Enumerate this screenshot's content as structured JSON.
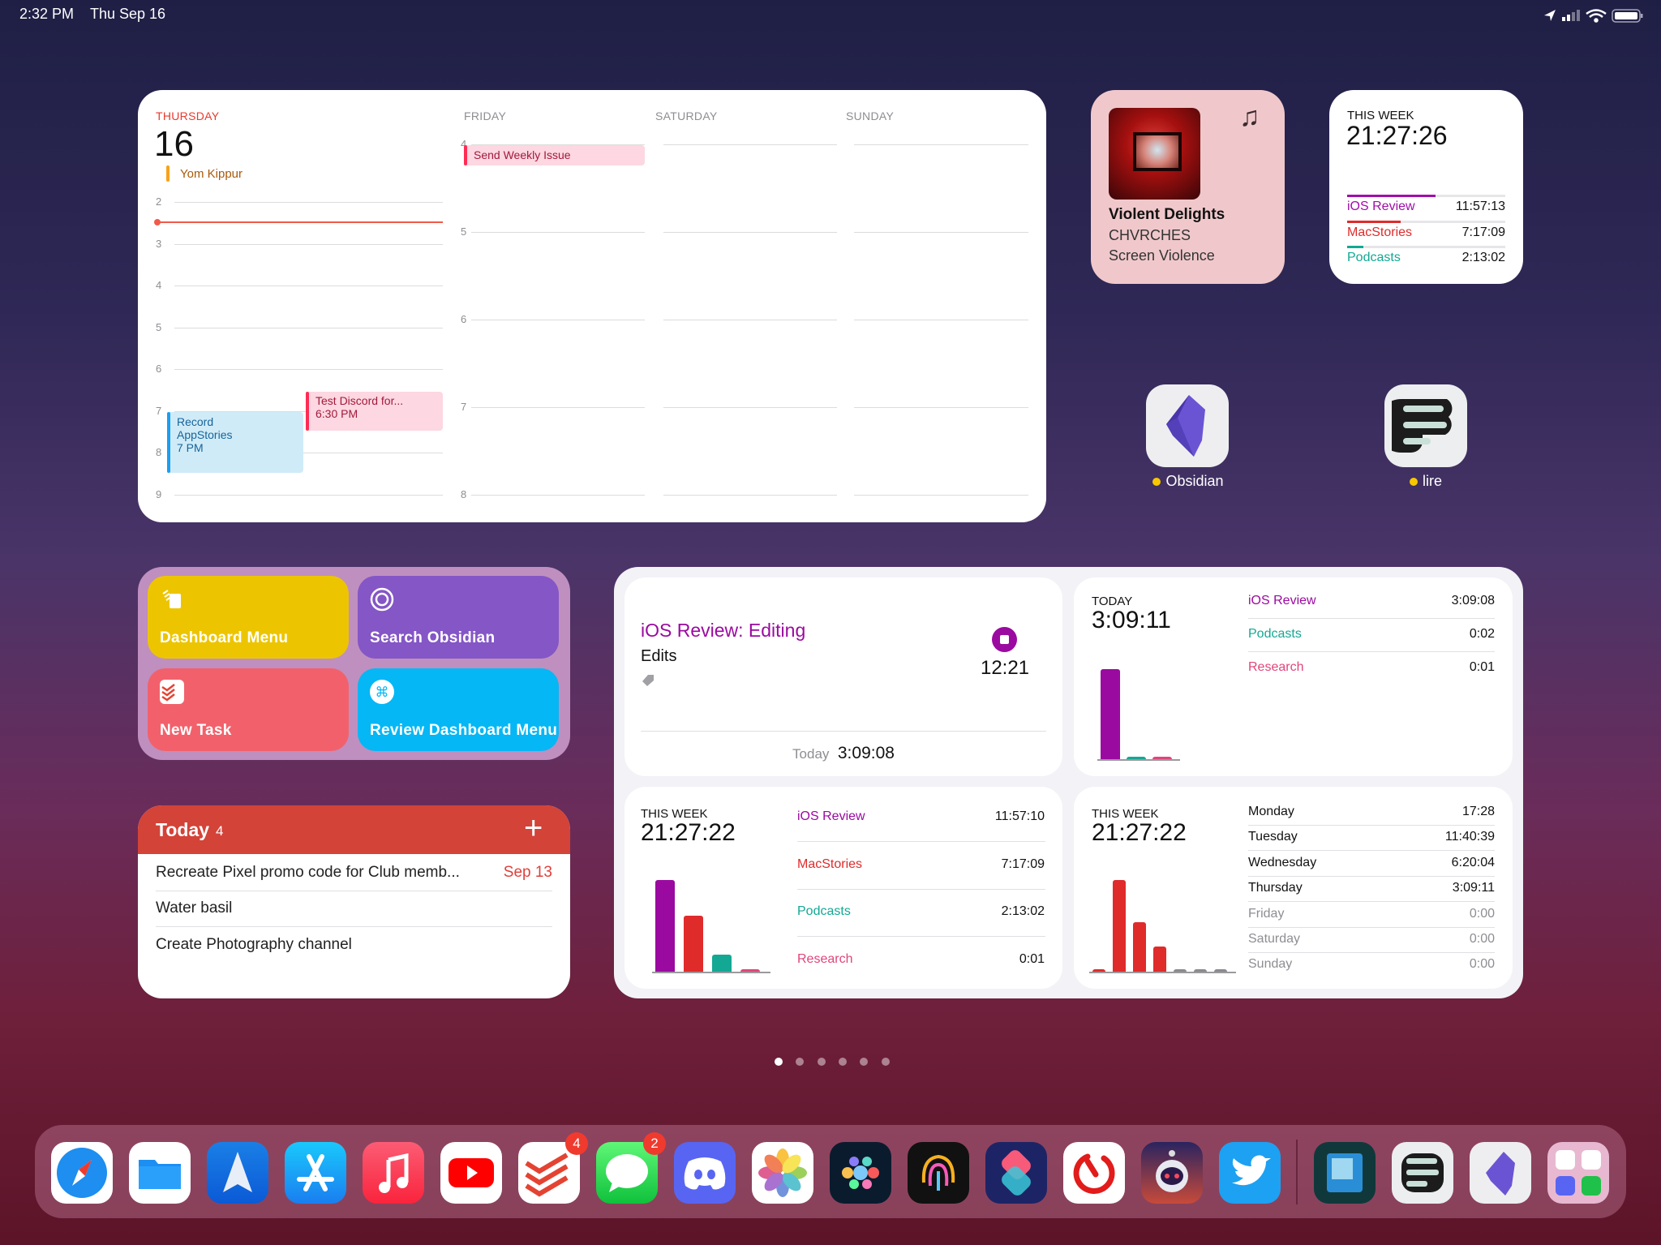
{
  "status_bar": {
    "time": "2:32 PM",
    "date": "Thu Sep 16",
    "icons": [
      "location-icon",
      "cellular-signal-icon",
      "wifi-icon",
      "battery-icon"
    ]
  },
  "calendar": {
    "today": {
      "weekday": "THURSDAY",
      "day": "16",
      "all_day_event": "Yom Kippur",
      "hours": [
        "2",
        "3",
        "4",
        "5",
        "6",
        "7",
        "8",
        "9"
      ],
      "events": [
        {
          "title": "Test Discord for...",
          "time": "6:30 PM",
          "color": "#ff2d55"
        },
        {
          "title_lines": [
            "Record",
            "AppStories"
          ],
          "time": "7 PM",
          "color": "#1a9ff0"
        }
      ]
    },
    "other_days": [
      {
        "weekday": "FRIDAY"
      },
      {
        "weekday": "SATURDAY"
      },
      {
        "weekday": "SUNDAY"
      }
    ],
    "later_hours": [
      "4",
      "5",
      "6",
      "7",
      "8"
    ],
    "friday_event": {
      "title": "Send Weekly Issue",
      "color": "#ff2d55"
    }
  },
  "music": {
    "title": "Violent Delights",
    "artist": "CHVRCHES",
    "album": "Screen Violence",
    "icon": "music-note-icon"
  },
  "timery_small": {
    "label": "THIS WEEK",
    "total": "21:27:26",
    "rows": [
      {
        "name": "iOS Review",
        "value": "11:57:13",
        "color": "#a00fa8"
      },
      {
        "name": "MacStories",
        "value": "7:17:09",
        "color": "#e02b2b"
      },
      {
        "name": "Podcasts",
        "value": "2:13:02",
        "color": "#13a894"
      }
    ]
  },
  "apps": [
    {
      "name": "Obsidian"
    },
    {
      "name": "lire"
    }
  ],
  "shortcuts": [
    {
      "label": "Dashboard Menu",
      "color": "#ecc500",
      "icon": "stack-icon"
    },
    {
      "label": "Search Obsidian",
      "color": "#8456c6",
      "icon": "target-icon"
    },
    {
      "label": "New Task",
      "color": "#f2616b",
      "icon": "todoist-icon"
    },
    {
      "label": "Review Dashboard Menu",
      "color": "#05b7f5",
      "icon": "command-icon"
    }
  ],
  "reminders": {
    "title": "Today",
    "count": "4",
    "add_icon": "plus-icon",
    "items": [
      {
        "text": "Recreate Pixel promo code for Club memb...",
        "due": "Sep 13"
      },
      {
        "text": "Water basil"
      },
      {
        "text": "Create Photography channel"
      }
    ]
  },
  "timery_large": {
    "running": {
      "title": "iOS Review: Editing",
      "description": "Edits",
      "elapsed": "12:21",
      "today_label": "Today",
      "today_value": "3:09:08",
      "color": "#9b0aa0"
    },
    "today": {
      "label": "TODAY",
      "total": "3:09:11",
      "rows": [
        {
          "name": "iOS Review",
          "value": "3:09:08",
          "color": "#9b0aa0"
        },
        {
          "name": "Podcasts",
          "value": "0:02",
          "color": "#13a894"
        },
        {
          "name": "Research",
          "value": "0:01",
          "color": "#e0457b"
        }
      ]
    },
    "week_projects": {
      "label": "THIS WEEK",
      "total": "21:27:22",
      "rows": [
        {
          "name": "iOS Review",
          "value": "11:57:10",
          "color": "#9b0aa0"
        },
        {
          "name": "MacStories",
          "value": "7:17:09",
          "color": "#e02b2b"
        },
        {
          "name": "Podcasts",
          "value": "2:13:02",
          "color": "#13a894"
        },
        {
          "name": "Research",
          "value": "0:01",
          "color": "#e0457b"
        }
      ]
    },
    "week_days": {
      "label": "THIS WEEK",
      "total": "21:27:22",
      "color": "#e02b2b",
      "rows": [
        {
          "name": "Monday",
          "value": "17:28"
        },
        {
          "name": "Tuesday",
          "value": "11:40:39"
        },
        {
          "name": "Wednesday",
          "value": "6:20:04"
        },
        {
          "name": "Thursday",
          "value": "3:09:11"
        },
        {
          "name": "Friday",
          "value": "0:00"
        },
        {
          "name": "Saturday",
          "value": "0:00"
        },
        {
          "name": "Sunday",
          "value": "0:00"
        }
      ]
    }
  },
  "page_indicator": {
    "pages": 6,
    "current": 1
  },
  "dock": {
    "apps": [
      {
        "icon": "safari-icon"
      },
      {
        "icon": "files-icon"
      },
      {
        "icon": "spark-icon"
      },
      {
        "icon": "app-store-icon"
      },
      {
        "icon": "music-icon"
      },
      {
        "icon": "youtube-icon"
      },
      {
        "icon": "todoist-icon",
        "badge": "4"
      },
      {
        "icon": "messages-icon",
        "badge": "2"
      },
      {
        "icon": "discord-icon"
      },
      {
        "icon": "photos-icon"
      },
      {
        "icon": "dots-app-icon"
      },
      {
        "icon": "fingerprint-app-icon"
      },
      {
        "icon": "shortcuts-icon"
      },
      {
        "icon": "timery-icon"
      },
      {
        "icon": "astronaut-app-icon"
      },
      {
        "icon": "twitter-icon"
      }
    ],
    "recents": [
      {
        "icon": "reader-app-icon"
      },
      {
        "icon": "lire-icon"
      },
      {
        "icon": "obsidian-icon"
      },
      {
        "icon": "app-folder-icon"
      }
    ]
  }
}
